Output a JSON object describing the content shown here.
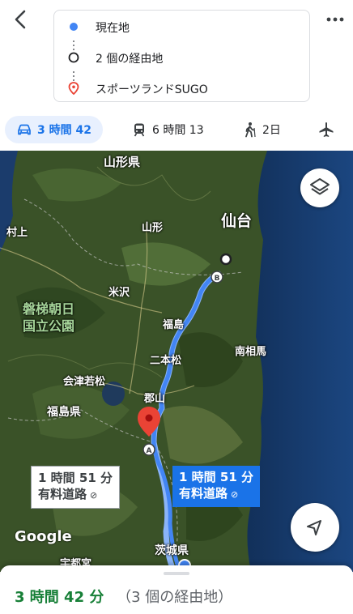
{
  "header": {
    "route": {
      "origin": "現在地",
      "waypoint": "2 個の経由地",
      "destination": "スポーツランドSUGO"
    }
  },
  "modes": [
    {
      "name": "car",
      "label": "3 時間 42",
      "icon": "car-icon",
      "active": true
    },
    {
      "name": "transit",
      "label": "6 時間 13",
      "icon": "train-icon",
      "active": false
    },
    {
      "name": "walk",
      "label": "2日",
      "icon": "walk-icon",
      "active": false
    },
    {
      "name": "flight",
      "label": "",
      "icon": "airplane-icon",
      "active": false
    }
  ],
  "map": {
    "labels": [
      "山形県",
      "仙台",
      "村上",
      "山形",
      "米沢",
      "磐梯朝日",
      "国立公園",
      "福島",
      "南相馬",
      "二本松",
      "会津若松",
      "郡山",
      "福島県",
      "茨城県",
      "宇都宮"
    ],
    "markers": {
      "a": "A",
      "b": "B"
    },
    "callout_primary": {
      "time": "1 時間 51 分",
      "note": "有料道路"
    },
    "callout_alt": {
      "time": "1 時間 51 分",
      "note": "有料道路"
    },
    "logo": "Google",
    "colors": {
      "route": "#1a73e8",
      "route_alt": "#8ab4f8",
      "pin": "#ea4335"
    }
  },
  "bottom": {
    "time": "3 時間 42 分",
    "via": "（3 個の経由地）"
  }
}
